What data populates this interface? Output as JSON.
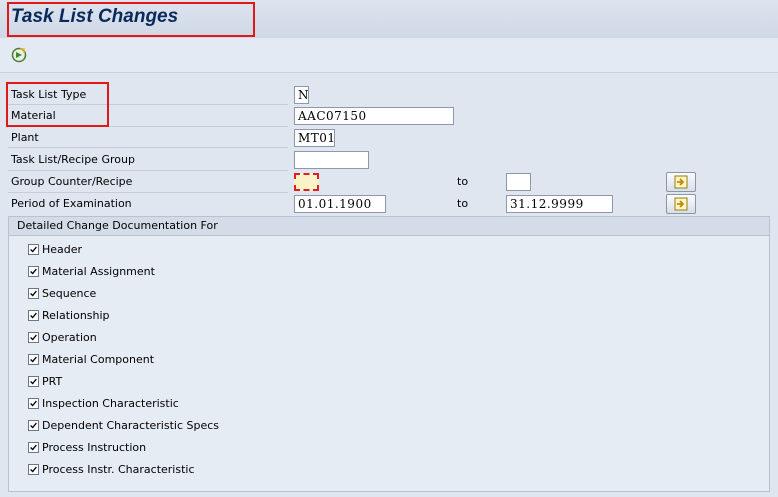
{
  "header": {
    "title": "Task List Changes"
  },
  "toolbar": {
    "execute_icon": "execute-icon"
  },
  "form": {
    "task_list_type": {
      "label": "Task List Type",
      "value": "N"
    },
    "material": {
      "label": "Material",
      "value": "AAC07150"
    },
    "plant": {
      "label": "Plant",
      "value": "MT01"
    },
    "task_list_group": {
      "label": "Task List/Recipe Group",
      "value": ""
    },
    "group_counter": {
      "label": "Group Counter/Recipe",
      "from": "",
      "to_label": "to",
      "to": ""
    },
    "period": {
      "label": "Period of Examination",
      "from": "01.01.1900",
      "to_label": "to",
      "to": "31.12.9999"
    }
  },
  "detail": {
    "title": "Detailed Change Documentation For",
    "items": [
      {
        "label": "Header",
        "checked": true
      },
      {
        "label": "Material Assignment",
        "checked": true
      },
      {
        "label": "Sequence",
        "checked": true
      },
      {
        "label": "Relationship",
        "checked": true
      },
      {
        "label": "Operation",
        "checked": true
      },
      {
        "label": "Material Component",
        "checked": true
      },
      {
        "label": "PRT",
        "checked": true
      },
      {
        "label": "Inspection Characteristic",
        "checked": true
      },
      {
        "label": "Dependent Characteristic Specs",
        "checked": true
      },
      {
        "label": "Process Instruction",
        "checked": true
      },
      {
        "label": "Process Instr. Characteristic",
        "checked": true
      }
    ]
  },
  "colors": {
    "highlight": "#e01818",
    "accent": "#0a2a5a"
  }
}
